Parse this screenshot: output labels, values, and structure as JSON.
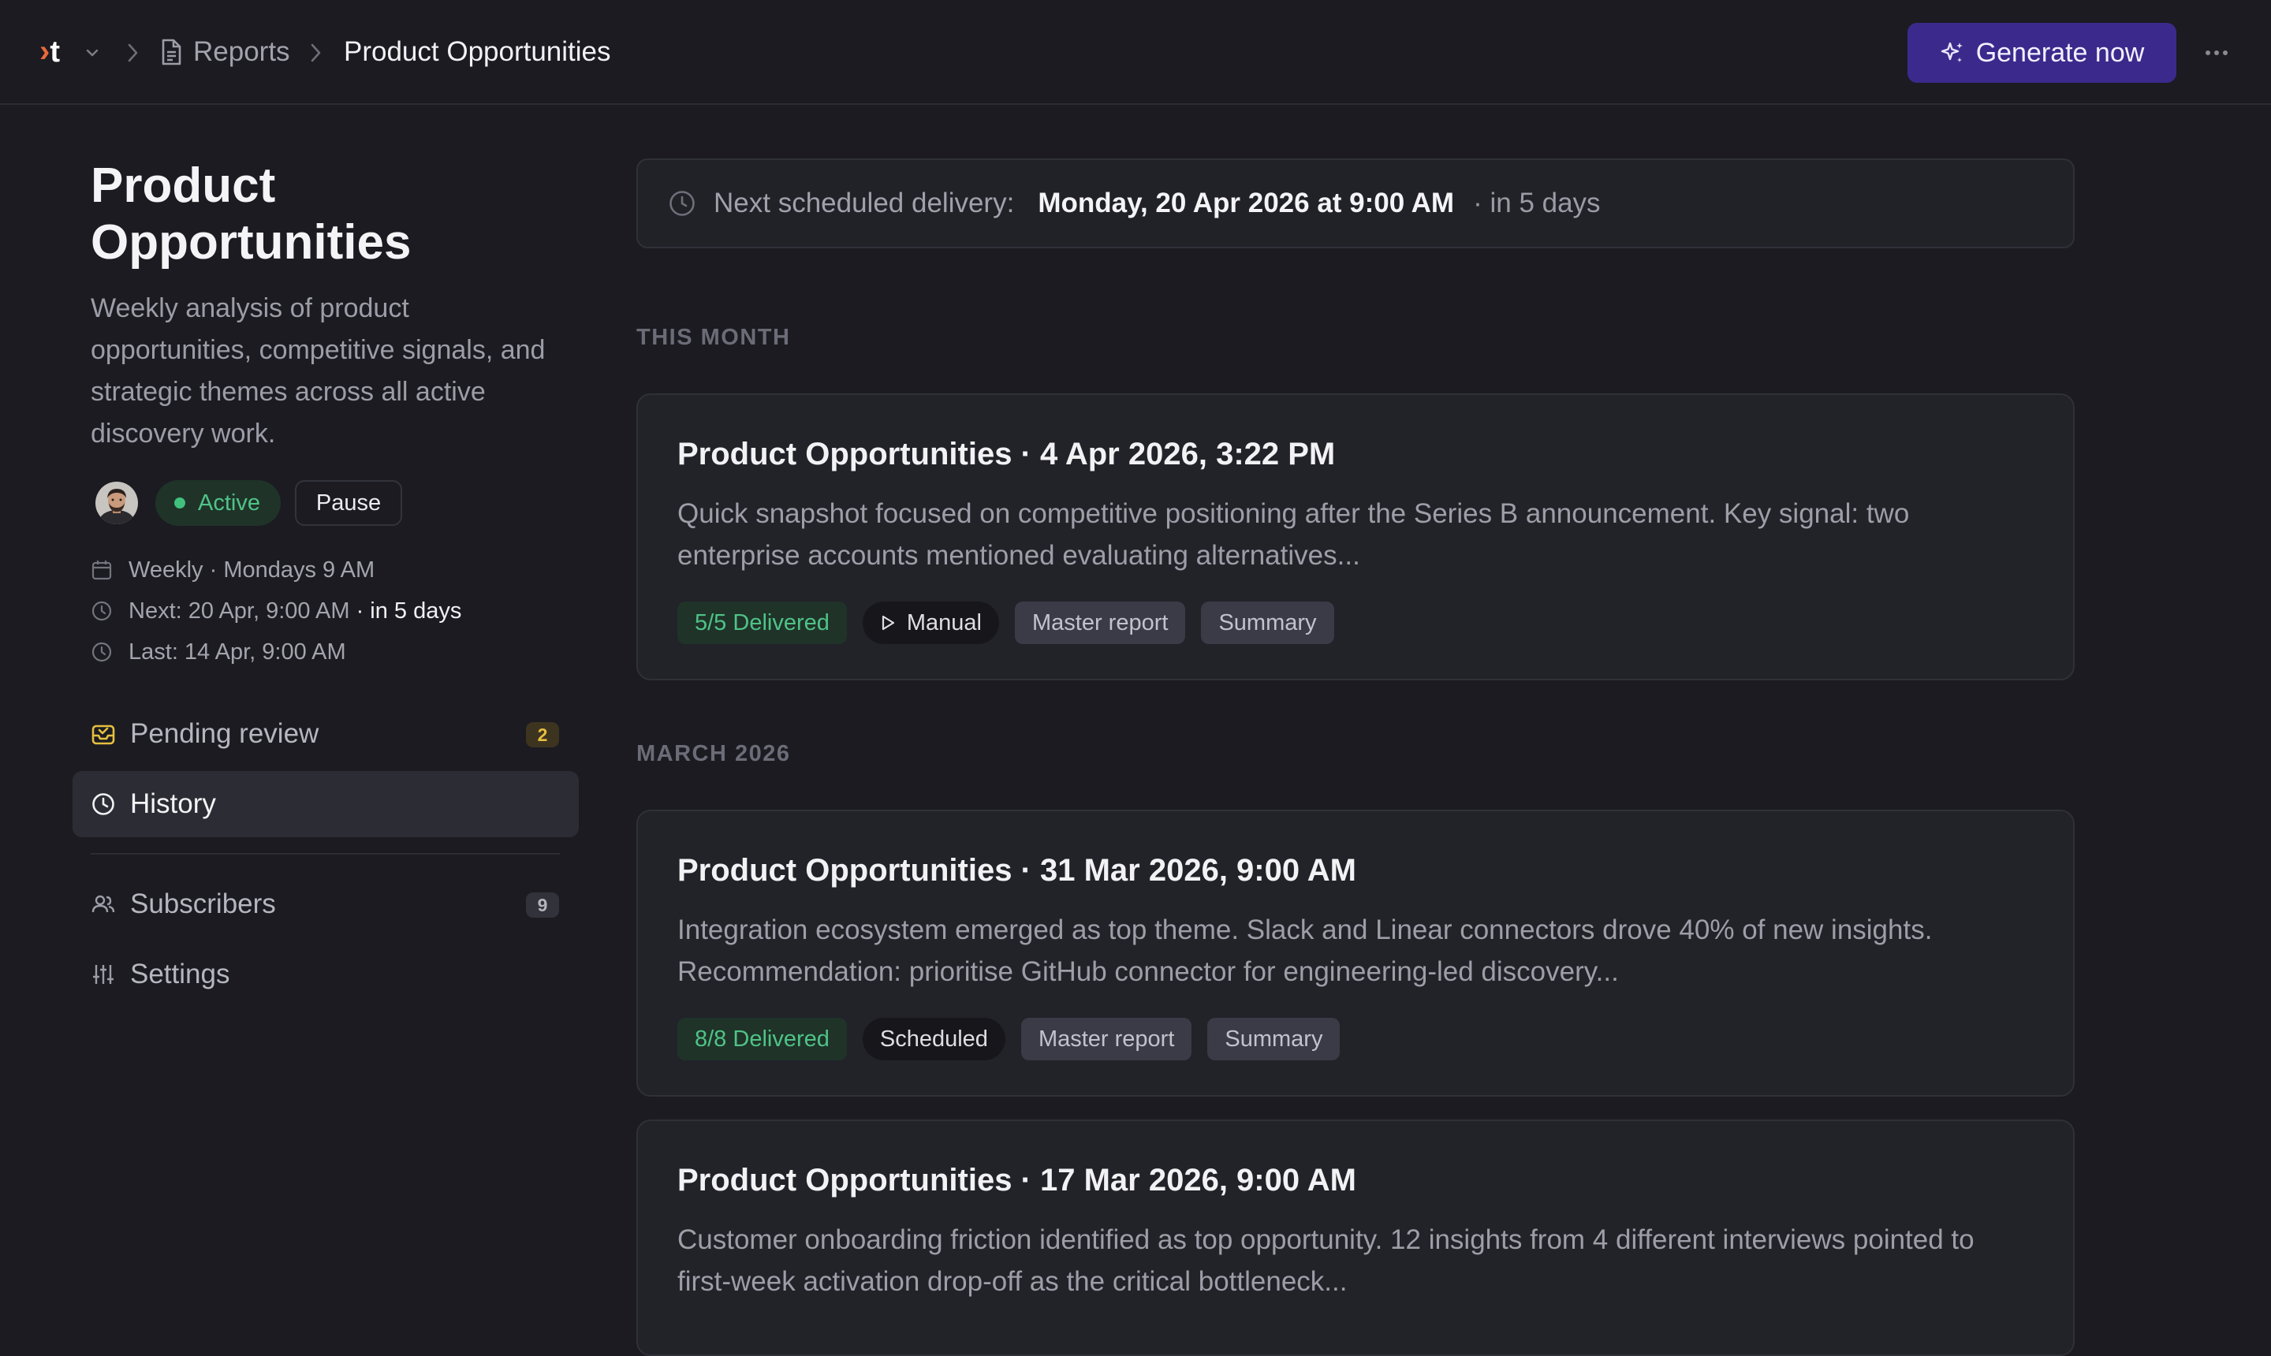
{
  "topbar": {
    "logo": {
      "part1": "›",
      "part2": "t"
    },
    "breadcrumb": [
      {
        "label": "Reports"
      },
      {
        "label": "Product Opportunities"
      }
    ],
    "generate_label": "Generate now"
  },
  "sidebar": {
    "title": "Product Opportunities",
    "description": "Weekly analysis of product opportunities, competitive signals, and strategic themes across all active discovery work.",
    "status_label": "Active",
    "pause_label": "Pause",
    "schedule": "Weekly · Mondays 9 AM",
    "next_run": "Next: 20 Apr, 9:00 AM",
    "next_relative": "· in 5 days",
    "last_run": "Last: 14 Apr, 9:00 AM",
    "nav": [
      {
        "label": "Pending review",
        "badge": "2",
        "icon": "inbox-icon"
      },
      {
        "label": "History",
        "active": true,
        "icon": "clock-icon"
      },
      {
        "label": "Subscribers",
        "badge": "9",
        "icon": "users-icon"
      },
      {
        "label": "Settings",
        "icon": "sliders-icon"
      }
    ]
  },
  "main": {
    "next_delivery": {
      "label": "Next scheduled delivery:",
      "date": "Monday, 20 Apr 2026 at 9:00 AM",
      "relative": "· in 5 days"
    },
    "sections": [
      {
        "heading": "THIS MONTH",
        "reports": [
          {
            "title": "Product Opportunities · 4 Apr 2026, 3:22 PM",
            "summary": "Quick snapshot focused on competitive positioning after the Series B announcement. Key signal: two enterprise accounts mentioned evaluating alternatives...",
            "delivered": "5/5 Delivered",
            "trigger": "Manual",
            "tags": [
              "Master report",
              "Summary"
            ]
          }
        ]
      },
      {
        "heading": "MARCH 2026",
        "reports": [
          {
            "title": "Product Opportunities · 31 Mar 2026, 9:00 AM",
            "summary": "Integration ecosystem emerged as top theme. Slack and Linear connectors drove 40% of new insights. Recommendation: prioritise GitHub connector for engineering-led discovery...",
            "delivered": "8/8 Delivered",
            "trigger": "Scheduled",
            "tags": [
              "Master report",
              "Summary"
            ]
          },
          {
            "title": "Product Opportunities · 17 Mar 2026, 9:00 AM",
            "summary": "Customer onboarding friction identified as top opportunity. 12 insights from 4 different interviews pointed to first-week activation drop-off as the critical bottleneck..."
          }
        ]
      }
    ]
  },
  "colors": {
    "background": "#1b1b21",
    "accent_button": "#3b2a8c",
    "status_green": "#4fc387",
    "badge_amber": "#e6bf3e",
    "logo_orange": "#e8693a"
  }
}
